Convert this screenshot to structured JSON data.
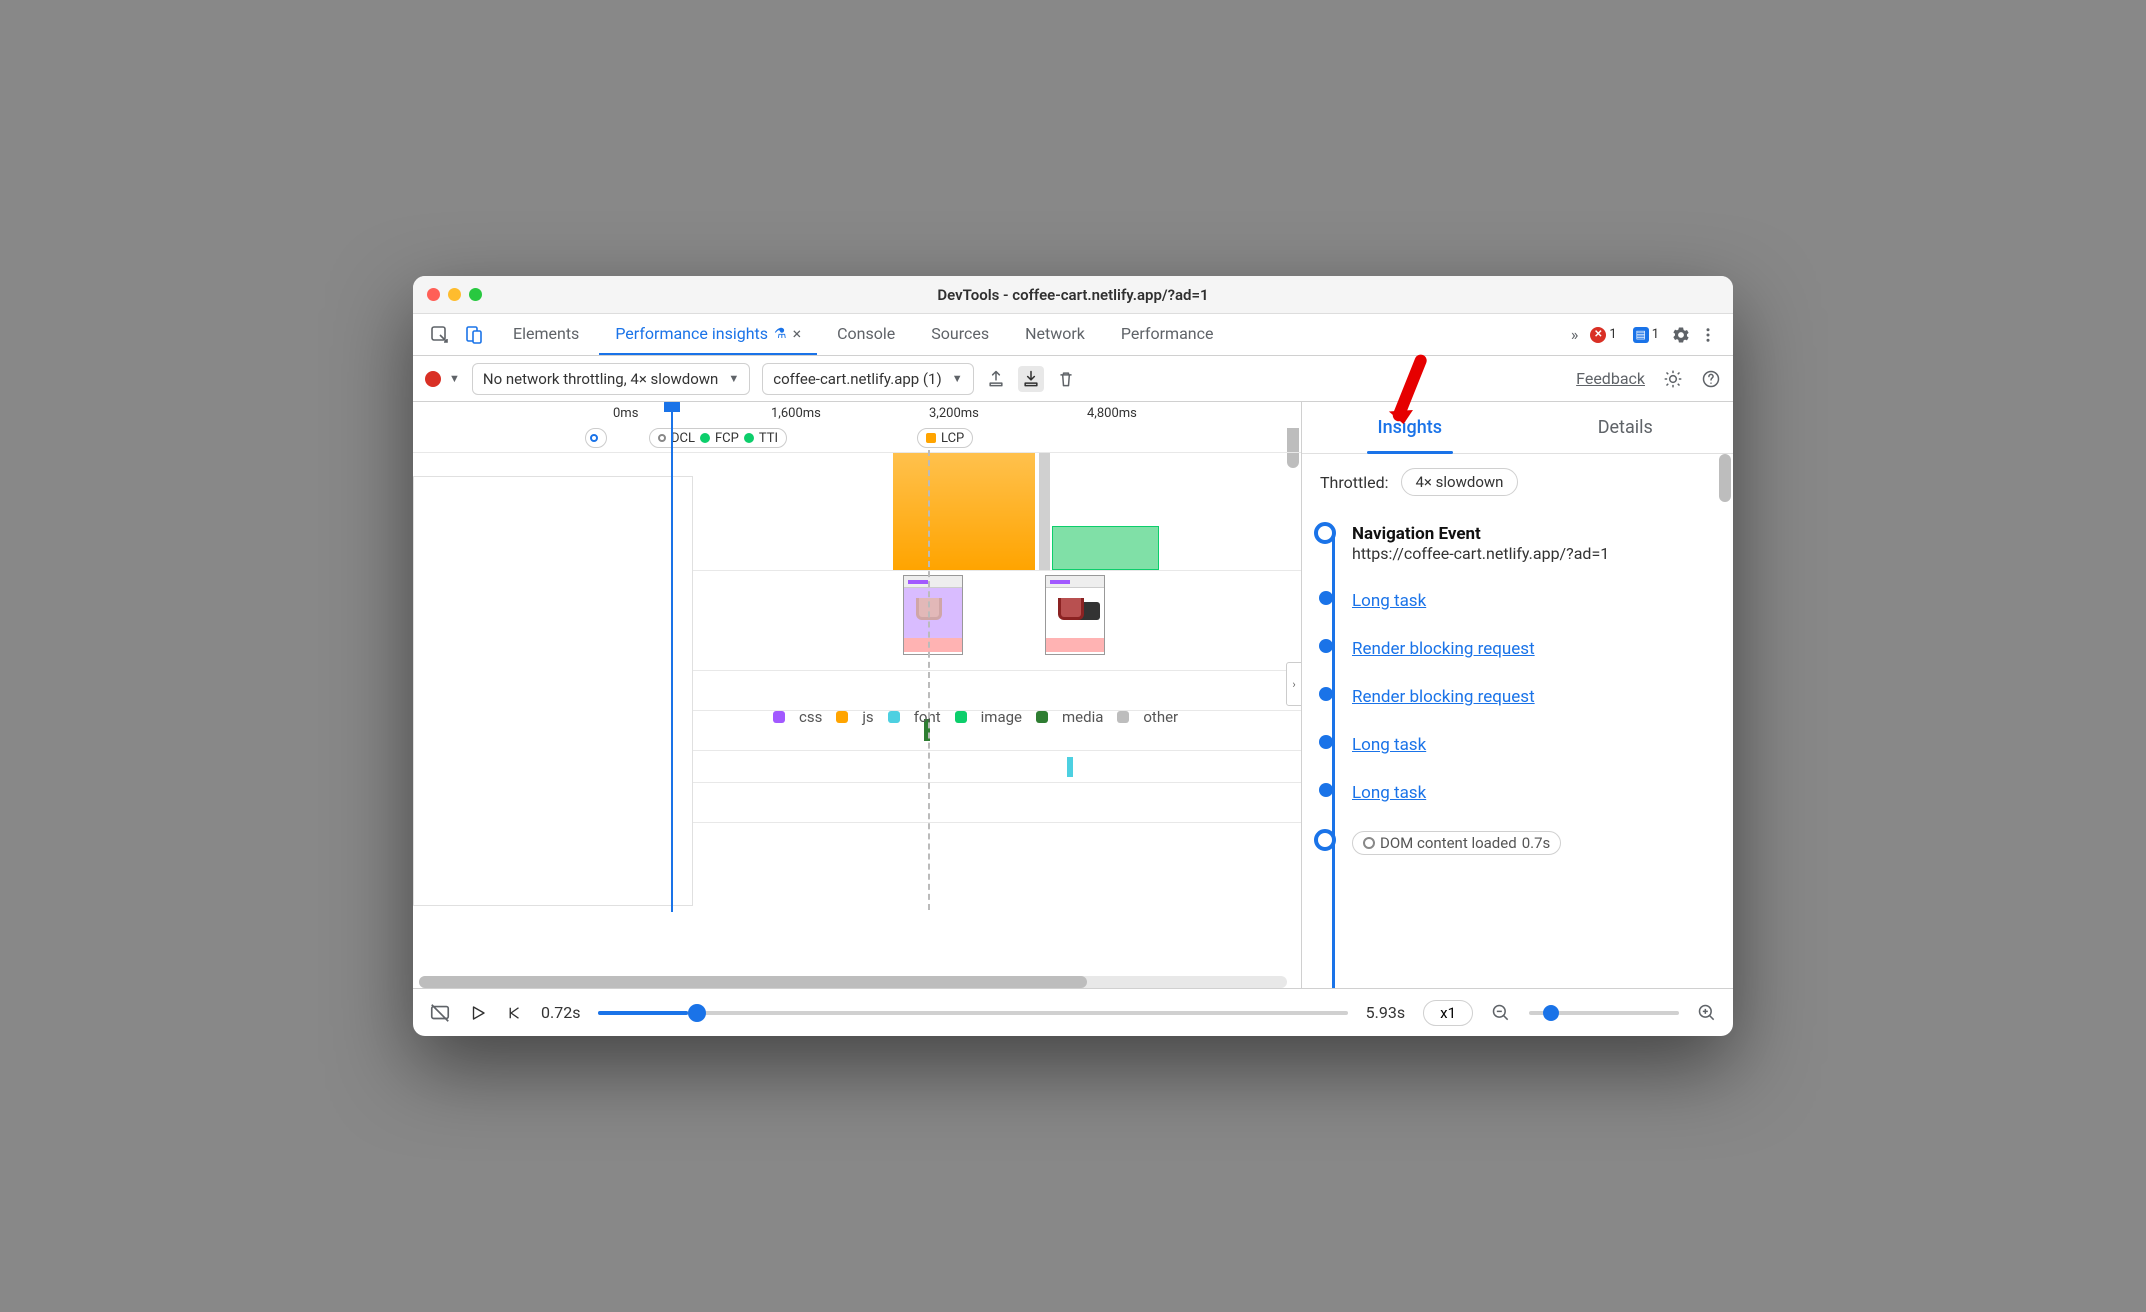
{
  "window": {
    "title": "DevTools - coffee-cart.netlify.app/?ad=1"
  },
  "tabs": {
    "items": [
      "Elements",
      "Performance insights",
      "Console",
      "Sources",
      "Network",
      "Performance"
    ],
    "active": 1,
    "experimental_flask": true,
    "overflow": "»"
  },
  "tabbar_badges": {
    "errors": "1",
    "messages": "1"
  },
  "toolbar": {
    "throttling_dropdown": "No network throttling, 4× slowdown",
    "recording_dropdown": "coffee-cart.netlify.app (1)",
    "feedback": "Feedback"
  },
  "ruler": {
    "ticks": [
      "0ms",
      "1,600ms",
      "3,200ms",
      "4,800ms"
    ]
  },
  "markers": {
    "group1": [
      "DCL",
      "FCP",
      "TTI"
    ],
    "group2": [
      "LCP"
    ]
  },
  "legend": [
    "css",
    "js",
    "font",
    "image",
    "media",
    "other"
  ],
  "sidebar": {
    "tabs": [
      "Insights",
      "Details"
    ],
    "active": 0,
    "throttled_label": "Throttled:",
    "throttled_value": "4× slowdown",
    "insights": [
      {
        "kind": "nav",
        "title": "Navigation Event",
        "sub": "https://coffee-cart.netlify.app/?ad=1"
      },
      {
        "kind": "link",
        "label": "Long task"
      },
      {
        "kind": "link",
        "label": "Render blocking request"
      },
      {
        "kind": "link",
        "label": "Render blocking request"
      },
      {
        "kind": "link",
        "label": "Long task"
      },
      {
        "kind": "link",
        "label": "Long task"
      },
      {
        "kind": "pill",
        "label": "DOM content loaded",
        "time": "0.7s"
      }
    ]
  },
  "footer": {
    "time_current": "0.72s",
    "time_end": "5.93s",
    "speed": "x1"
  }
}
